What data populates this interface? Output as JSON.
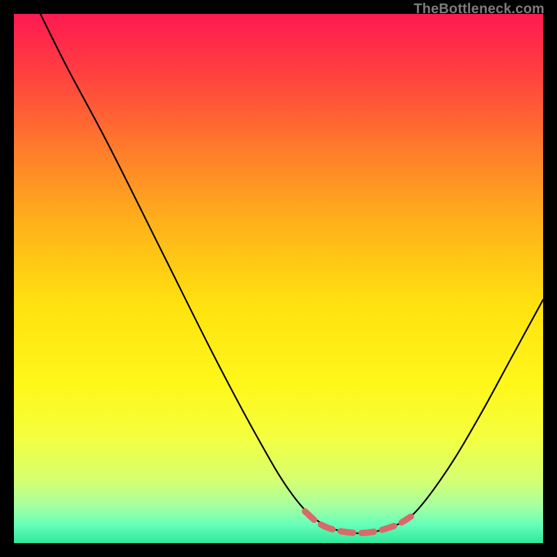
{
  "watermark": {
    "text": "TheBottleneck.com"
  },
  "chart_data": {
    "type": "line",
    "title": "",
    "xlabel": "",
    "ylabel": "",
    "xlim": [
      0,
      100
    ],
    "ylim": [
      0,
      100
    ],
    "background_gradient": {
      "stops": [
        {
          "offset": 0.0,
          "color": "#ff1a52"
        },
        {
          "offset": 0.1,
          "color": "#ff3b41"
        },
        {
          "offset": 0.25,
          "color": "#ff7a2c"
        },
        {
          "offset": 0.4,
          "color": "#ffb31a"
        },
        {
          "offset": 0.55,
          "color": "#ffe20f"
        },
        {
          "offset": 0.7,
          "color": "#fff71a"
        },
        {
          "offset": 0.8,
          "color": "#f4ff3f"
        },
        {
          "offset": 0.88,
          "color": "#d6ff70"
        },
        {
          "offset": 0.93,
          "color": "#a6ffa0"
        },
        {
          "offset": 0.965,
          "color": "#66ffba"
        },
        {
          "offset": 1.0,
          "color": "#2fe89a"
        }
      ]
    },
    "series": [
      {
        "name": "bottleneck-curve",
        "color": "#000000",
        "width": 2.2,
        "points": [
          {
            "x": 5.0,
            "y": 100.0
          },
          {
            "x": 10.0,
            "y": 90.0
          },
          {
            "x": 18.0,
            "y": 75.0
          },
          {
            "x": 28.0,
            "y": 55.0
          },
          {
            "x": 38.0,
            "y": 35.0
          },
          {
            "x": 46.0,
            "y": 20.0
          },
          {
            "x": 52.0,
            "y": 10.0
          },
          {
            "x": 57.0,
            "y": 4.5
          },
          {
            "x": 62.0,
            "y": 2.2
          },
          {
            "x": 67.0,
            "y": 2.0
          },
          {
            "x": 72.0,
            "y": 3.3
          },
          {
            "x": 76.0,
            "y": 6.0
          },
          {
            "x": 82.0,
            "y": 14.0
          },
          {
            "x": 88.0,
            "y": 24.0
          },
          {
            "x": 94.0,
            "y": 35.0
          },
          {
            "x": 100.0,
            "y": 46.0
          }
        ]
      },
      {
        "name": "optimal-range-marker",
        "color": "#d86a6a",
        "width": 9,
        "dash": "18 12",
        "points": [
          {
            "x": 55.0,
            "y": 6.0
          },
          {
            "x": 58.0,
            "y": 3.5
          },
          {
            "x": 62.0,
            "y": 2.2
          },
          {
            "x": 67.0,
            "y": 2.0
          },
          {
            "x": 72.0,
            "y": 3.3
          },
          {
            "x": 75.0,
            "y": 5.0
          }
        ]
      }
    ]
  }
}
